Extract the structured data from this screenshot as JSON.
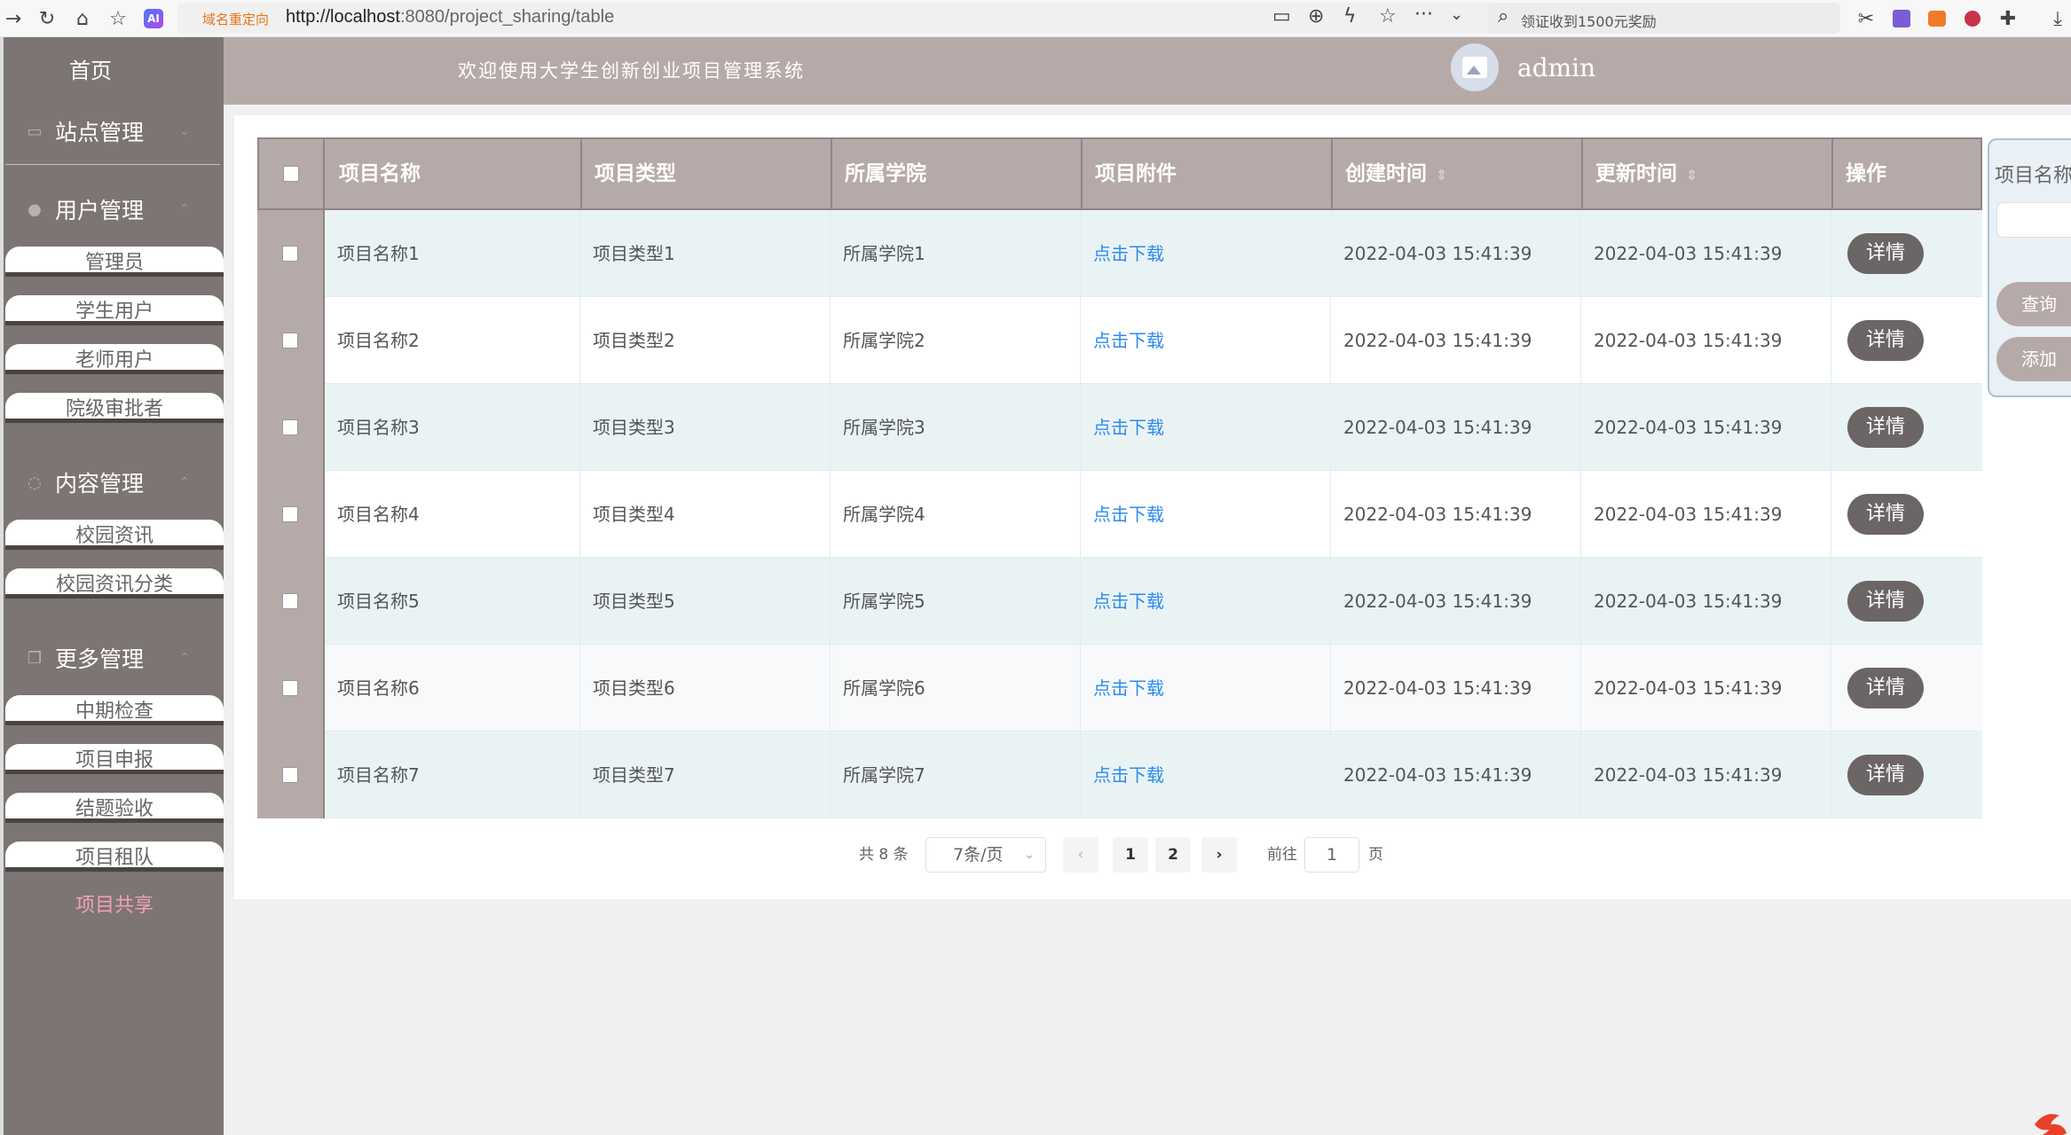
{
  "browser": {
    "redirect_tag": "域名重定向",
    "url_host": "http://localhost",
    "url_rest": ":8080/project_sharing/table",
    "search_hint": "领证收到1500元奖励"
  },
  "sidebar": {
    "home": "首页",
    "groups": [
      {
        "label": "站点管理"
      },
      {
        "label": "用户管理"
      },
      {
        "label": "内容管理"
      },
      {
        "label": "更多管理"
      }
    ],
    "items": [
      {
        "label": "管理员"
      },
      {
        "label": "学生用户"
      },
      {
        "label": "老师用户"
      },
      {
        "label": "院级审批者"
      },
      {
        "label": "校园资讯"
      },
      {
        "label": "校园资讯分类"
      },
      {
        "label": "中期检查"
      },
      {
        "label": "项目申报"
      },
      {
        "label": "结题验收"
      },
      {
        "label": "项目租队"
      },
      {
        "label": "项目共享"
      }
    ]
  },
  "header": {
    "welcome": "欢迎使用大学生创新创业项目管理系统",
    "user": "admin"
  },
  "table": {
    "columns": [
      "项目名称",
      "项目类型",
      "所属学院",
      "项目附件",
      "创建时间",
      "更新时间",
      "操作"
    ],
    "rows": [
      {
        "name": "项目名称1",
        "type": "项目类型1",
        "college": "所属学院1",
        "attachment": "点击下载",
        "created": "2022-04-03 15:41:39",
        "updated": "2022-04-03 15:41:39",
        "action": "详情"
      },
      {
        "name": "项目名称2",
        "type": "项目类型2",
        "college": "所属学院2",
        "attachment": "点击下载",
        "created": "2022-04-03 15:41:39",
        "updated": "2022-04-03 15:41:39",
        "action": "详情"
      },
      {
        "name": "项目名称3",
        "type": "项目类型3",
        "college": "所属学院3",
        "attachment": "点击下载",
        "created": "2022-04-03 15:41:39",
        "updated": "2022-04-03 15:41:39",
        "action": "详情"
      },
      {
        "name": "项目名称4",
        "type": "项目类型4",
        "college": "所属学院4",
        "attachment": "点击下载",
        "created": "2022-04-03 15:41:39",
        "updated": "2022-04-03 15:41:39",
        "action": "详情"
      },
      {
        "name": "项目名称5",
        "type": "项目类型5",
        "college": "所属学院5",
        "attachment": "点击下载",
        "created": "2022-04-03 15:41:39",
        "updated": "2022-04-03 15:41:39",
        "action": "详情"
      },
      {
        "name": "项目名称6",
        "type": "项目类型6",
        "college": "所属学院6",
        "attachment": "点击下载",
        "created": "2022-04-03 15:41:39",
        "updated": "2022-04-03 15:41:39",
        "action": "详情"
      },
      {
        "name": "项目名称7",
        "type": "项目类型7",
        "college": "所属学院7",
        "attachment": "点击下载",
        "created": "2022-04-03 15:41:39",
        "updated": "2022-04-03 15:41:39",
        "action": "详情"
      }
    ]
  },
  "search_panel": {
    "label": "项目名称",
    "input_value": "",
    "query": "查询",
    "add": "添加"
  },
  "pagination": {
    "total_text": "共 8 条",
    "page_size": "7条/页",
    "pages": [
      "1",
      "2"
    ],
    "current_page": "1",
    "goto_label": "前往",
    "goto_value": "1",
    "page_unit": "页"
  },
  "colors": {
    "sidebar_bg": "#7d7474",
    "header_bg": "#b6aaa9",
    "row_alt_bg": "#eaf3f4",
    "link": "#2d8cf0",
    "active_item": "#f0a1b6",
    "button_dark": "#6b6565"
  }
}
